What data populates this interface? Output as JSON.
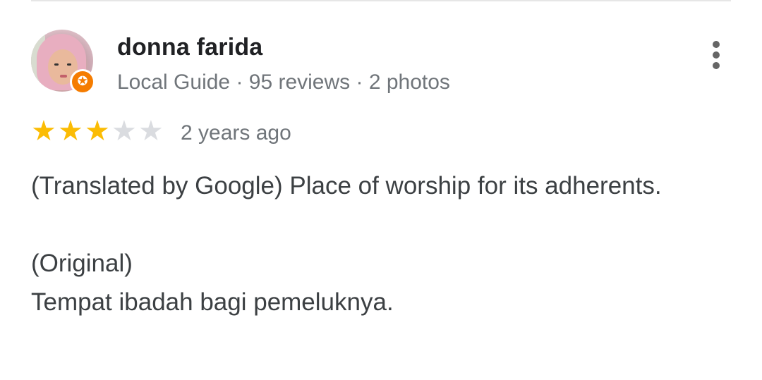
{
  "review": {
    "author_name": "donna farida",
    "author_meta": "Local Guide · 95 reviews · 2 photos",
    "rating": 3,
    "max_rating": 5,
    "star_filled_color": "#fbbc04",
    "star_empty_color": "#dadce0",
    "badge_color": "#f57c00",
    "time_ago": "2 years ago",
    "translated_text": "(Translated by Google) Place of worship for its adherents.",
    "original_label": "(Original)",
    "original_text": "Tempat ibadah bagi pemeluknya.",
    "more_icon": "more-vertical-icon",
    "badge_icon": "local-guide-star-icon"
  }
}
